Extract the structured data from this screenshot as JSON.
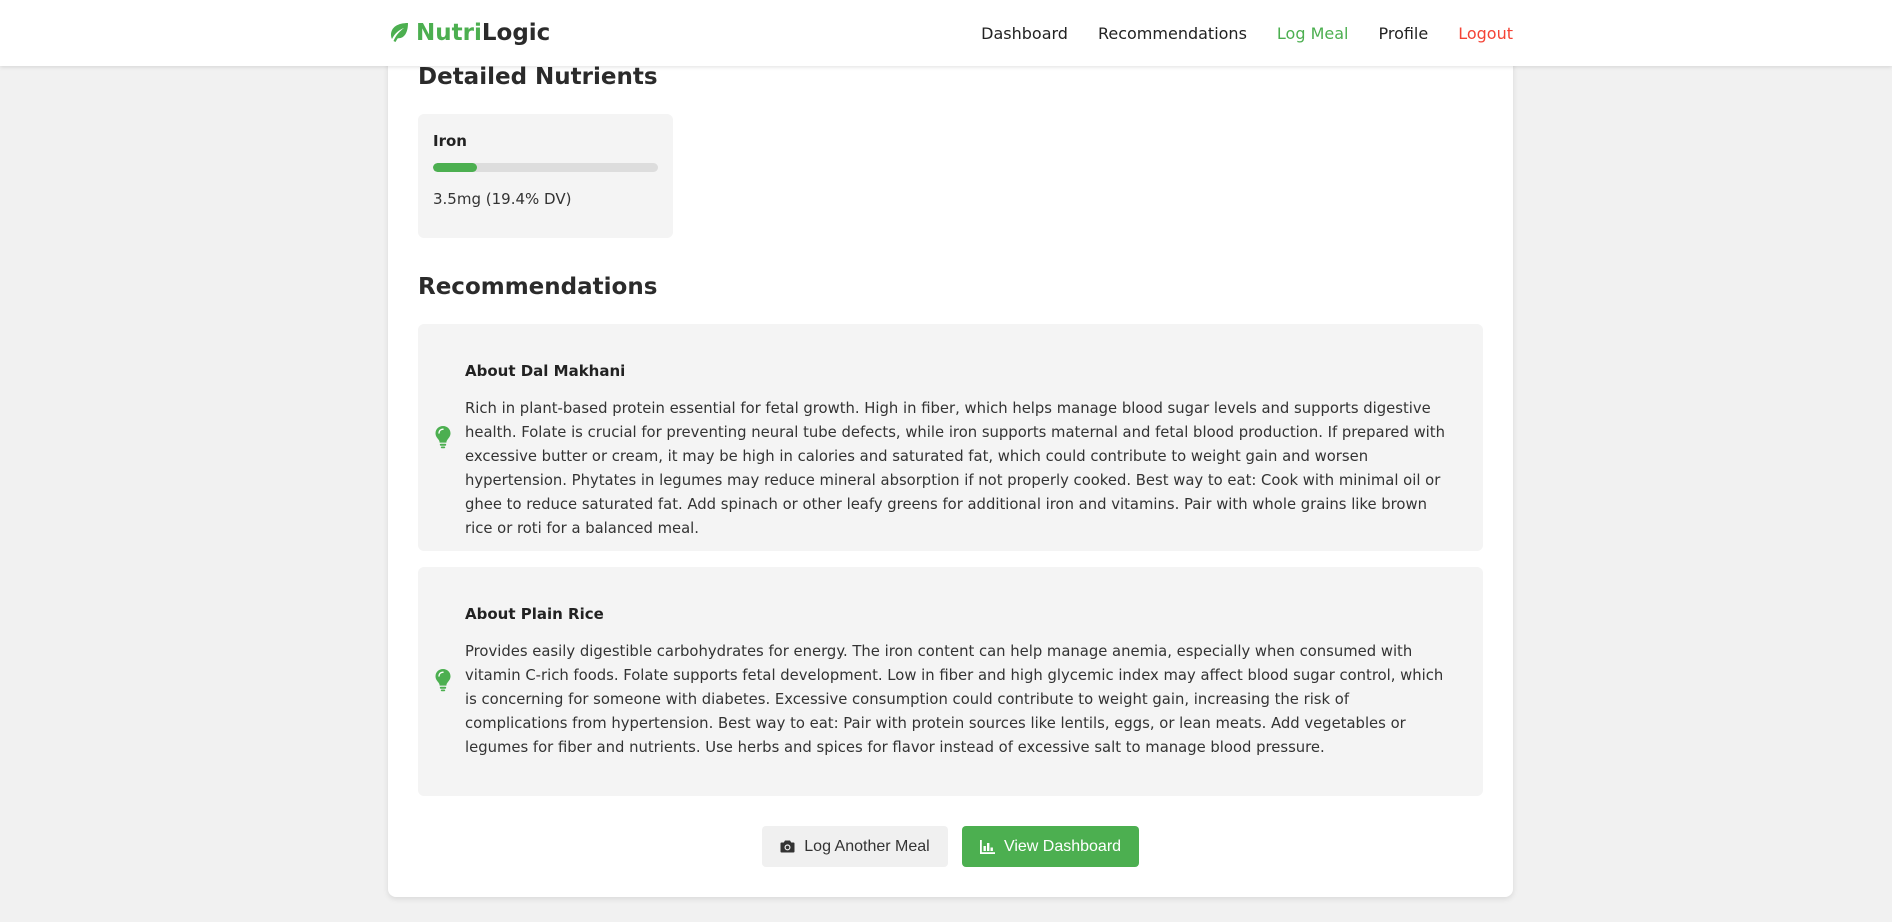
{
  "brand": {
    "part1": "Nutri",
    "part2": "Logic",
    "icon": "leaf-icon"
  },
  "nav": {
    "items": [
      {
        "label": "Dashboard",
        "state": "default"
      },
      {
        "label": "Recommendations",
        "state": "default"
      },
      {
        "label": "Log Meal",
        "state": "active"
      },
      {
        "label": "Profile",
        "state": "default"
      },
      {
        "label": "Logout",
        "state": "danger"
      }
    ]
  },
  "nutrients": {
    "title": "Detailed Nutrients",
    "items": [
      {
        "name": "Iron",
        "value_text": "3.5mg (19.4% DV)",
        "percent_dv": 19.4
      }
    ]
  },
  "recommendations": {
    "title": "Recommendations",
    "icon": "lightbulb-icon",
    "items": [
      {
        "title": "About Dal Makhani",
        "text": "Rich in plant-based protein essential for fetal growth. High in fiber, which helps manage blood sugar levels and supports digestive health. Folate is crucial for preventing neural tube defects, while iron supports maternal and fetal blood production. If prepared with excessive butter or cream, it may be high in calories and saturated fat, which could contribute to weight gain and worsen hypertension. Phytates in legumes may reduce mineral absorption if not properly cooked. Best way to eat: Cook with minimal oil or ghee to reduce saturated fat. Add spinach or other leafy greens for additional iron and vitamins. Pair with whole grains like brown rice or roti for a balanced meal."
      },
      {
        "title": "About Plain Rice",
        "text": "Provides easily digestible carbohydrates for energy. The iron content can help manage anemia, especially when consumed with vitamin C-rich foods. Folate supports fetal development. Low in fiber and high glycemic index may affect blood sugar control, which is concerning for someone with diabetes. Excessive consumption could contribute to weight gain, increasing the risk of complications from hypertension. Best way to eat: Pair with protein sources like lentils, eggs, or lean meats. Add vegetables or legumes for fiber and nutrients. Use herbs and spices for flavor instead of excessive salt to manage blood pressure."
      }
    ]
  },
  "actions": {
    "log_another": {
      "label": "Log Another Meal",
      "icon": "camera-icon"
    },
    "view_dashboard": {
      "label": "View Dashboard",
      "icon": "chart-icon"
    }
  },
  "colors": {
    "accent": "#4caf50",
    "danger": "#f44336",
    "background": "#f1f1f1"
  }
}
